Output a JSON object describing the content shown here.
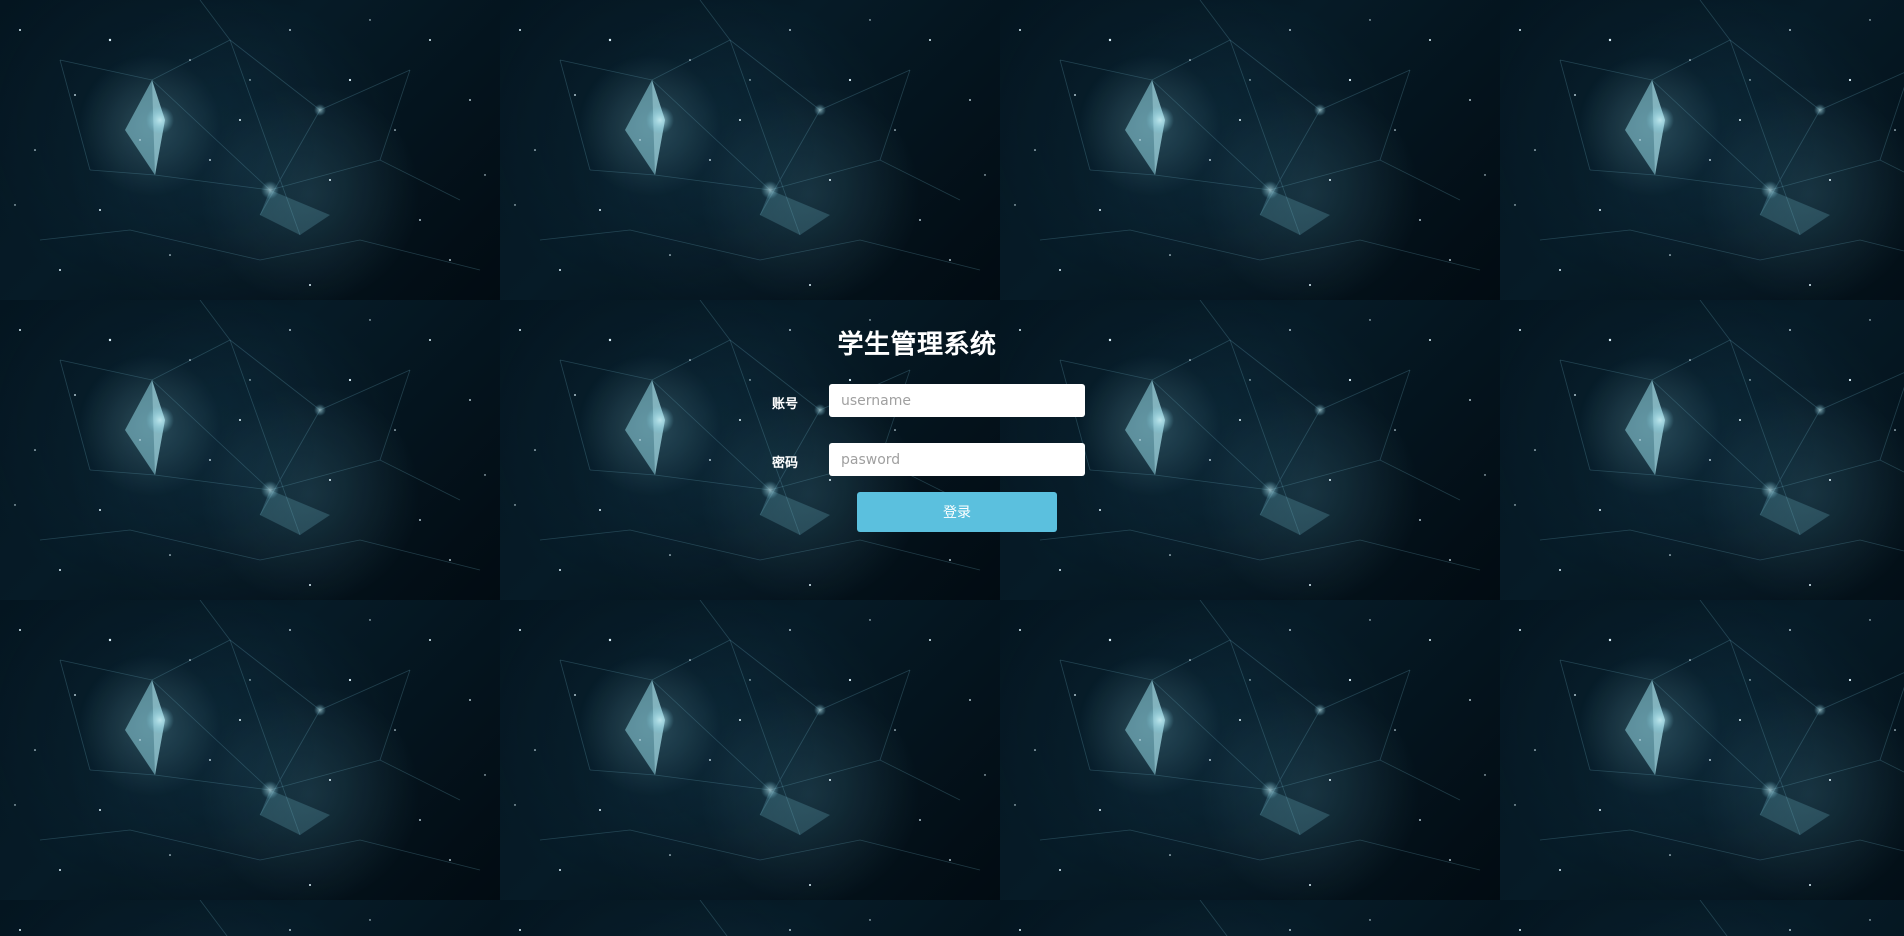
{
  "login": {
    "title": "学生管理系统",
    "username_label": "账号",
    "username_placeholder": "username",
    "username_value": "",
    "password_label": "密码",
    "password_placeholder": "pasword",
    "password_value": "",
    "submit_label": "登录"
  },
  "colors": {
    "background": "#03111a",
    "button": "#5bc0de",
    "text": "#ffffff"
  }
}
